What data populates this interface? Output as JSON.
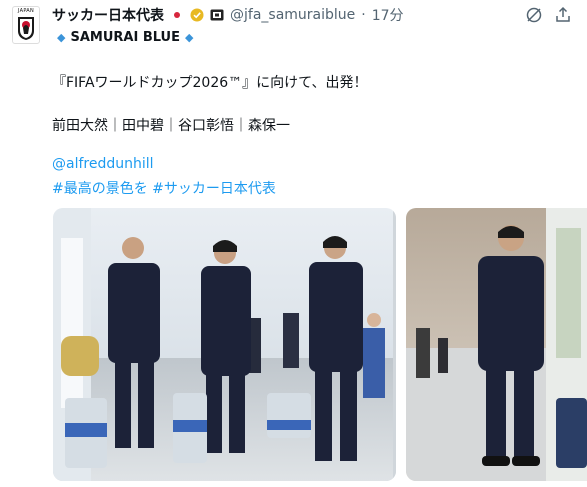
{
  "account": {
    "name": "サッカー日本代表",
    "handle": "@jfa_samuraiblue",
    "separator": "·",
    "time": "17分",
    "avatar_caption": "JAPAN"
  },
  "tweet": {
    "subtitle": "SAMURAI BLUE",
    "line1": "『FIFAワールドカップ2026™』に向けて、出発！",
    "line2": "前田大然｜田中碧｜谷口彰悟｜森保一",
    "mention": "@alfreddunhill",
    "hashtags": "#最高の景色を #サッカー日本代表"
  },
  "colors": {
    "link": "#1d9bf0",
    "text": "#0f1419",
    "muted": "#536471",
    "suit_navy": "#1c2238"
  },
  "icons": [
    "japan-flag-icon",
    "verified-badge-icon",
    "affiliate-tag-icon",
    "grok-icon",
    "share-icon"
  ]
}
